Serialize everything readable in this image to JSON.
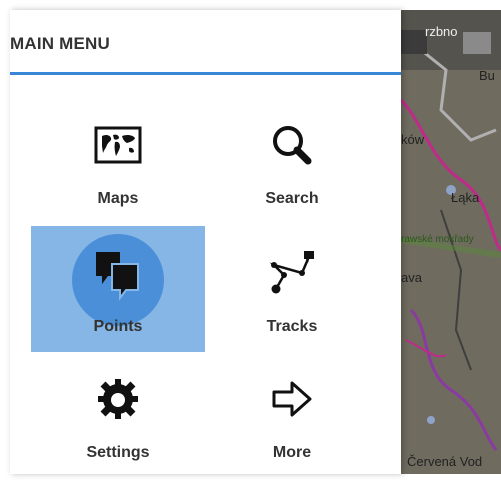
{
  "drawer": {
    "title": "MAIN MENU",
    "items": [
      {
        "label": "Maps",
        "icon": "world-map-icon"
      },
      {
        "label": "Search",
        "icon": "magnifier-icon"
      },
      {
        "label": "Points",
        "icon": "points-bubbles-icon",
        "selected": true
      },
      {
        "label": "Tracks",
        "icon": "track-path-icon"
      },
      {
        "label": "Settings",
        "icon": "gear-icon"
      },
      {
        "label": "More",
        "icon": "arrow-right-icon"
      }
    ]
  },
  "map": {
    "labels": [
      "rzbno",
      "Bu",
      "ków",
      "Łąka",
      "rawské mokřady",
      "ava",
      "Červená Vod"
    ]
  },
  "colors": {
    "accent": "#3a86d6",
    "selected_tile": "#85b6e6",
    "ripple": "#4a8fd8",
    "text": "#333333"
  }
}
